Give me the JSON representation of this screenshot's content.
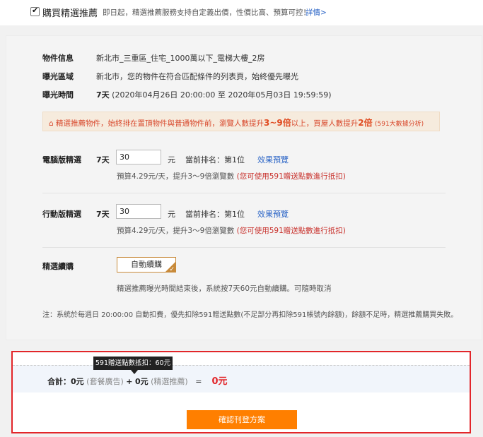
{
  "header": {
    "checked": true,
    "checkmark": "✔",
    "title": "購買精選推薦",
    "description": "即日起，精選推薦服務支持自定義出價，性價比高、預算可控！",
    "details_link": "詳情>"
  },
  "property": {
    "info_label": "物件信息",
    "info_value": "新北市_三重區_住宅_1000萬以下_電梯大樓_2房",
    "area_label": "曝光區域",
    "area_value": "新北市，您的物件在符合匹配條件的列表頁，始終優先曝光",
    "time_label": "曝光時間",
    "time_days": "7天",
    "time_range": "(2020年04月26日 20:00:00 至 2020年05月03日 19:59:59)"
  },
  "notice": {
    "icon": "⌂",
    "text_1": "精選推薦物件，始終排在置頂物件與普通物件前，瀏覽人數提升",
    "highlight_1": "3~9倍",
    "text_2": "以上，買屋人數提升",
    "highlight_2": "2倍",
    "source": "(591大數據分析)"
  },
  "desktop": {
    "label": "電腦版精選",
    "days": "7天",
    "bid_value": "30",
    "unit": "元",
    "rank_text": "當前排名：第",
    "rank_value": "1",
    "rank_suffix": "位",
    "preview_link": "效果預覽",
    "budget_text": "預算4.29元/天，提升3～9倍瀏覽數",
    "points_note": "(您可使用591贈送點數進行抵扣)"
  },
  "mobile": {
    "label": "行動版精選",
    "days": "7天",
    "bid_value": "30",
    "unit": "元",
    "rank_text": "當前排名：第",
    "rank_value": "1",
    "rank_suffix": "位",
    "preview_link": "效果預覽",
    "budget_text": "預算4.29元/天，提升3～9倍瀏覽數",
    "points_note": "(您可使用591贈送點數進行抵扣)"
  },
  "renewal": {
    "label": "精選續購",
    "button": "自動續購",
    "selected": true,
    "description": "精選推薦曝光時間結束後，系統按7天60元自動續購。可隨時取消"
  },
  "footnote": "注：系統於每週日 20:00:00 自動扣費，優先扣除591贈送點數(不足部分再扣除591帳號內餘額)，餘額不足時，精選推薦購買失敗。",
  "summary": {
    "tooltip": "591贈送點數抵扣：60元",
    "total_label": "合計：",
    "package_amount": "0元",
    "package_label": "(套餐廣告)",
    "plus": "+",
    "featured_amount": "0元",
    "featured_label": "(精選推薦)",
    "equals": "=",
    "grand_total": "0元",
    "confirm_button": "確認刊登方案"
  },
  "colors": {
    "accent_orange": "#ff7f00",
    "highlight_red": "#e2262a",
    "link_blue": "#2a64c6"
  }
}
